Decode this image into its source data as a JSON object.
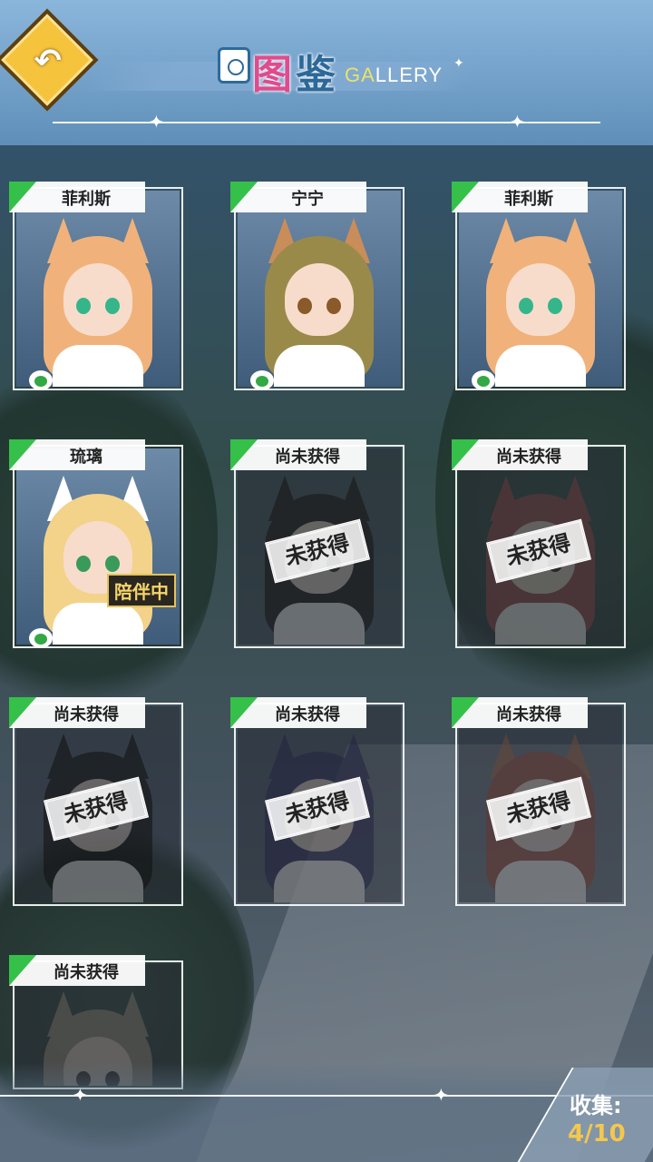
{
  "header": {
    "title_cn_1": "图",
    "title_cn_2": "鉴",
    "title_en_first": "GA",
    "title_en_rest": "LLERY"
  },
  "colors": {
    "accent_green": "#35c04a",
    "accent_gold": "#f4c84c",
    "back_button": "#f6c33c",
    "title_pink": "#e04b8c",
    "title_blue": "#2c6898"
  },
  "cards": [
    {
      "name": "菲利斯",
      "owned": true,
      "stamp": "",
      "badge": ""
    },
    {
      "name": "宁宁",
      "owned": true,
      "stamp": "",
      "badge": ""
    },
    {
      "name": "菲利斯",
      "owned": true,
      "stamp": "",
      "badge": ""
    },
    {
      "name": "琉璃",
      "owned": true,
      "stamp": "",
      "badge": "陪伴中"
    },
    {
      "name": "尚未获得",
      "owned": false,
      "stamp": "未获得",
      "badge": ""
    },
    {
      "name": "尚未获得",
      "owned": false,
      "stamp": "未获得",
      "badge": ""
    },
    {
      "name": "尚未获得",
      "owned": false,
      "stamp": "未获得",
      "badge": ""
    },
    {
      "name": "尚未获得",
      "owned": false,
      "stamp": "未获得",
      "badge": ""
    },
    {
      "name": "尚未获得",
      "owned": false,
      "stamp": "未获得",
      "badge": ""
    },
    {
      "name": "尚未获得",
      "owned": false,
      "stamp": "",
      "badge": ""
    }
  ],
  "footer": {
    "collect_label": "收集:",
    "collect_value": "4/10"
  }
}
